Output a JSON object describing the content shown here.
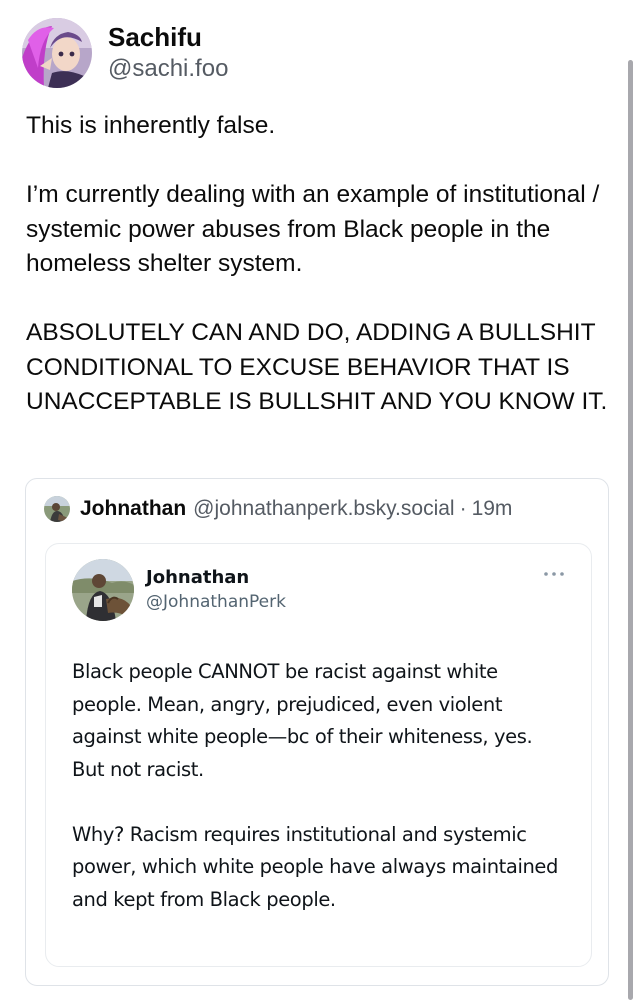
{
  "post": {
    "author": {
      "display_name": "Sachifu",
      "handle": "@sachi.foo"
    },
    "paragraphs": [
      "This is inherently false.",
      "I’m currently dealing with an example of institutional / systemic power abuses from Black people in the homeless shelter system.",
      "ABSOLUTELY CAN AND DO, ADDING A BULLSHIT CONDITIONAL TO EXCUSE BEHAVIOR THAT IS UNACCEPTABLE IS BULLSHIT AND YOU KNOW IT."
    ]
  },
  "quote": {
    "display_name": "Johnathan",
    "handle": "@johnathanperk.bsky.social",
    "separator": "·",
    "time": "19m",
    "embedded_tweet": {
      "display_name": "Johnathan",
      "handle": "@JohnathanPerk",
      "more_icon": "ellipsis-icon",
      "paragraphs": [
        "Black people CANNOT be racist against white people. Mean, angry, prejudiced, even violent against white people—bc of their whiteness, yes. But not racist.",
        "Why? Racism requires institutional and systemic power, which white people have always maintained and kept from Black people."
      ]
    }
  }
}
